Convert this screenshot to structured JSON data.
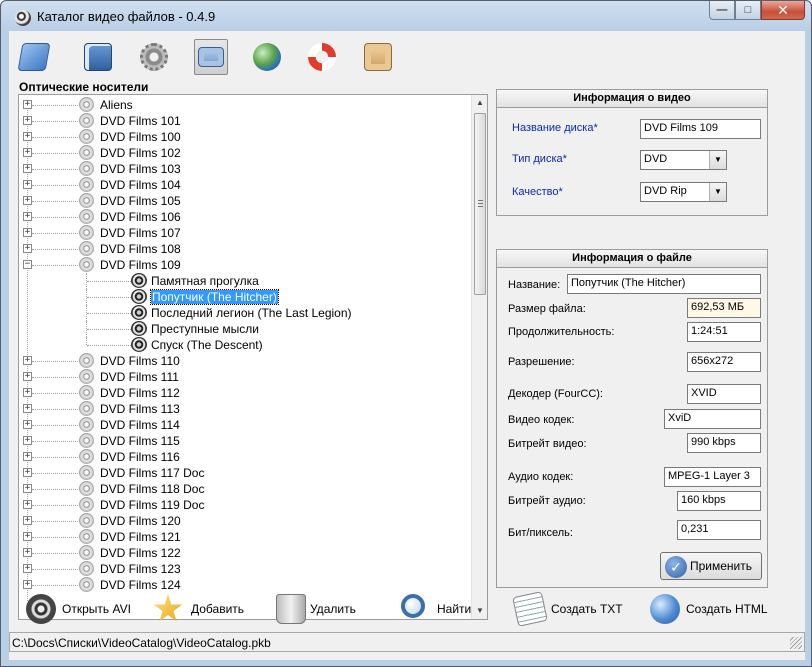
{
  "window": {
    "title": "Каталог видео файлов - 0.4.9"
  },
  "toolbar": {
    "icons": [
      "book-icon",
      "save-disk-icon",
      "gear-icon",
      "camera-icon",
      "globe-icon",
      "lifebuoy-icon",
      "album-icon"
    ],
    "active_index": 3
  },
  "left_panel": {
    "title": "Оптические носители"
  },
  "tree": {
    "discs_before": [
      "Aliens",
      "DVD Films 101",
      "DVD Films 100",
      "DVD Films 102",
      "DVD Films 103",
      "DVD Films 104",
      "DVD Films 105",
      "DVD Films 106",
      "DVD Films 107",
      "DVD Films 108"
    ],
    "expanded_disc": "DVD Films 109",
    "films": [
      "Памятная прогулка",
      "Попутчик (The Hitcher)",
      "Последний легион (The Last Legion)",
      "Преступные мысли",
      "Спуск (The Descent)"
    ],
    "selected_film_index": 1,
    "discs_after": [
      "DVD Films 110",
      "DVD Films 111",
      "DVD Films 112",
      "DVD Films 113",
      "DVD Films 114",
      "DVD Films 115",
      "DVD Films 116",
      "DVD Films 117 Doc",
      "DVD Films 118 Doc",
      "DVD Films 119 Doc",
      "DVD Films 120",
      "DVD Films 121",
      "DVD Films 122",
      "DVD Films 123",
      "DVD Films 124"
    ]
  },
  "video_info": {
    "title": "Информация о видео",
    "disc_name_label": "Название диска*",
    "disc_name_value": "DVD Films 109",
    "disc_type_label": "Тип диска*",
    "disc_type_value": "DVD",
    "quality_label": "Качество*",
    "quality_value": "DVD Rip"
  },
  "file_info": {
    "title": "Информация о файле",
    "name_label": "Название:",
    "name_value": "Попутчик (The Hitcher)",
    "size_label": "Размер файла:",
    "size_value": "692,53 МБ",
    "duration_label": "Продолжительность:",
    "duration_value": "1:24:51",
    "resolution_label": "Разрешение:",
    "resolution_value": "656x272",
    "decoder_label": "Декодер (FourCC):",
    "decoder_value": "XVID",
    "video_codec_label": "Видео кодек:",
    "video_codec_value": "XviD",
    "video_bitrate_label": "Битрейт видео:",
    "video_bitrate_value": "990 kbps",
    "audio_codec_label": "Аудио кодек:",
    "audio_codec_value": "MPEG-1 Layer 3",
    "audio_bitrate_label": "Битрейт аудио:",
    "audio_bitrate_value": "160 kbps",
    "bpp_label": "Бит/пиксель:",
    "bpp_value": "0,231",
    "apply_label": "Применить"
  },
  "bottom_toolbar": {
    "open_avi": "Открыть AVI",
    "add": "Добавить",
    "delete": "Удалить",
    "find": "Найти",
    "create_txt": "Создать TXT",
    "create_html": "Создать HTML"
  },
  "statusbar": {
    "path": "C:\\Docs\\Списки\\VideoCatalog\\VideoCatalog.pkb"
  },
  "colors": {
    "selection": "#3399ff",
    "required_label": "#0b2aa6",
    "window_frame": "#b9cfe6"
  }
}
